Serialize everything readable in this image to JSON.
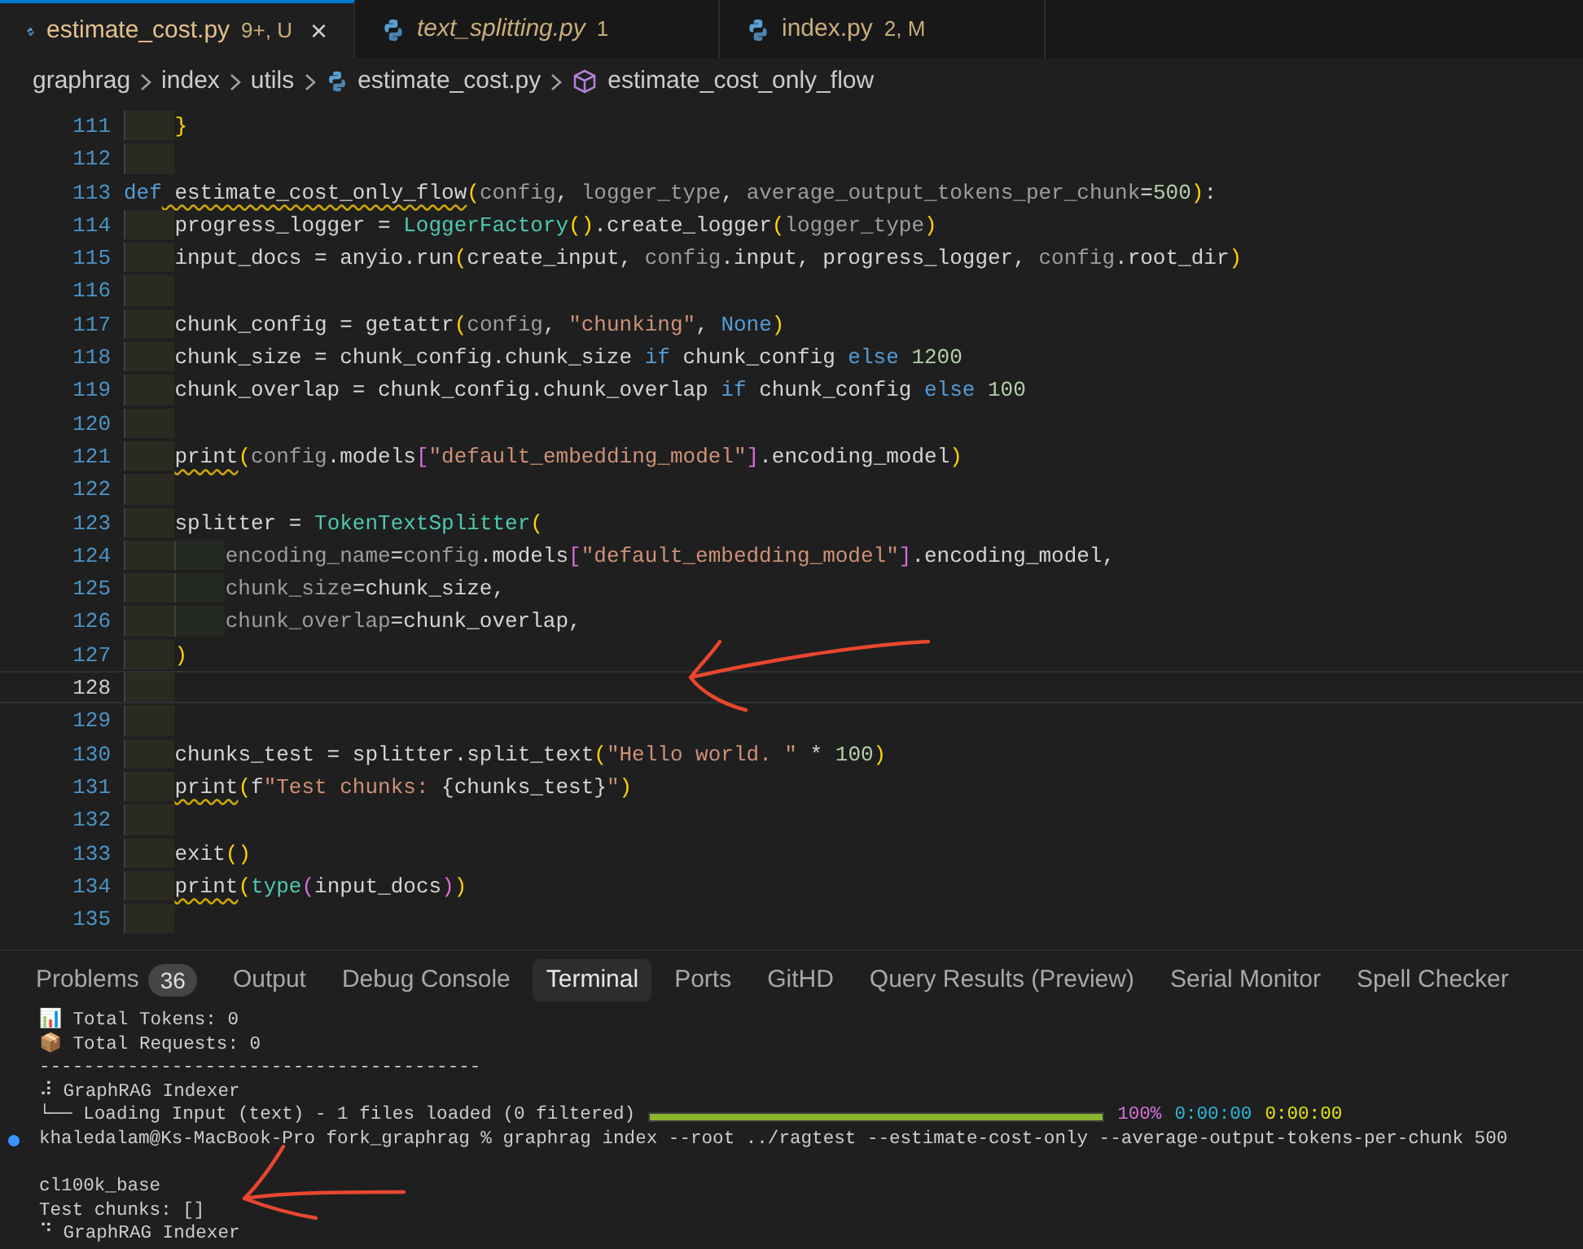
{
  "tabs": [
    {
      "label": "estimate_cost.py",
      "badge": "9+, U",
      "selected": true,
      "preview": false,
      "close": "×"
    },
    {
      "label": "text_splitting.py",
      "badge": "1",
      "selected": false,
      "preview": true
    },
    {
      "label": "index.py",
      "badge": "2, M",
      "selected": false,
      "preview": false
    }
  ],
  "breadcrumbs": [
    {
      "label": "graphrag",
      "kind": "folder"
    },
    {
      "label": "index",
      "kind": "folder"
    },
    {
      "label": "utils",
      "kind": "folder"
    },
    {
      "label": "estimate_cost.py",
      "kind": "file"
    },
    {
      "label": "estimate_cost_only_flow",
      "kind": "symbol"
    }
  ],
  "code_lines": [
    {
      "number": "111",
      "current": false,
      "tokens": [
        {
          "text": "    }",
          "kind": "brace"
        }
      ]
    },
    {
      "number": "112",
      "current": false
    },
    {
      "number": "113",
      "current": false,
      "tokens": [
        {
          "text": "def",
          "kind": "keyword"
        },
        {
          "text": " estimate_cost_only_flow",
          "kind": "plain",
          "squiggle": true
        },
        {
          "text": "(",
          "kind": "brace"
        },
        {
          "text": "config",
          "kind": "param"
        },
        {
          "text": ", ",
          "kind": "plain"
        },
        {
          "text": "logger_type",
          "kind": "param"
        },
        {
          "text": ", ",
          "kind": "plain"
        },
        {
          "text": "average_output_tokens_per_chunk",
          "kind": "param"
        },
        {
          "text": "=",
          "kind": "plain"
        },
        {
          "text": "500",
          "kind": "number"
        },
        {
          "text": ")",
          "kind": "brace"
        },
        {
          "text": ":",
          "kind": "plain"
        }
      ]
    },
    {
      "number": "114",
      "current": false,
      "tokens": [
        {
          "text": "    progress_logger = ",
          "kind": "plain"
        },
        {
          "text": "LoggerFactory",
          "kind": "class"
        },
        {
          "text": "()",
          "kind": "brace"
        },
        {
          "text": ".create_logger",
          "kind": "plain"
        },
        {
          "text": "(",
          "kind": "brace"
        },
        {
          "text": "logger_type",
          "kind": "param"
        },
        {
          "text": ")",
          "kind": "brace"
        }
      ]
    },
    {
      "number": "115",
      "current": false,
      "tokens": [
        {
          "text": "    input_docs = anyio.run",
          "kind": "plain"
        },
        {
          "text": "(",
          "kind": "brace"
        },
        {
          "text": "create_input, ",
          "kind": "plain"
        },
        {
          "text": "config",
          "kind": "param"
        },
        {
          "text": ".input, progress_logger, ",
          "kind": "plain"
        },
        {
          "text": "config",
          "kind": "param"
        },
        {
          "text": ".root_dir",
          "kind": "plain"
        },
        {
          "text": ")",
          "kind": "brace"
        }
      ]
    },
    {
      "number": "116",
      "current": false
    },
    {
      "number": "117",
      "current": false,
      "tokens": [
        {
          "text": "    chunk_config = getattr",
          "kind": "plain"
        },
        {
          "text": "(",
          "kind": "brace"
        },
        {
          "text": "config",
          "kind": "param"
        },
        {
          "text": ", ",
          "kind": "plain"
        },
        {
          "text": "\"chunking\"",
          "kind": "string"
        },
        {
          "text": ", ",
          "kind": "plain"
        },
        {
          "text": "None",
          "kind": "keyword"
        },
        {
          "text": ")",
          "kind": "brace"
        }
      ]
    },
    {
      "number": "118",
      "current": false,
      "tokens": [
        {
          "text": "    chunk_size = chunk_config.chunk_size ",
          "kind": "plain"
        },
        {
          "text": "if",
          "kind": "keyword"
        },
        {
          "text": " chunk_config ",
          "kind": "plain"
        },
        {
          "text": "else",
          "kind": "keyword"
        },
        {
          "text": " 1200",
          "kind": "number"
        }
      ]
    },
    {
      "number": "119",
      "current": false,
      "tokens": [
        {
          "text": "    chunk_overlap = chunk_config.chunk_overlap ",
          "kind": "plain"
        },
        {
          "text": "if",
          "kind": "keyword"
        },
        {
          "text": " chunk_config ",
          "kind": "plain"
        },
        {
          "text": "else",
          "kind": "keyword"
        },
        {
          "text": " 100",
          "kind": "number"
        }
      ]
    },
    {
      "number": "120",
      "current": false
    },
    {
      "number": "121",
      "current": false,
      "tokens": [
        {
          "text": "    print",
          "kind": "plain",
          "squiggle": true
        },
        {
          "text": "(",
          "kind": "brace"
        },
        {
          "text": "config",
          "kind": "param"
        },
        {
          "text": ".models",
          "kind": "plain"
        },
        {
          "text": "[",
          "kind": "bracket"
        },
        {
          "text": "\"default_embedding_model\"",
          "kind": "string"
        },
        {
          "text": "]",
          "kind": "bracket"
        },
        {
          "text": ".encoding_model",
          "kind": "plain"
        },
        {
          "text": ")",
          "kind": "brace"
        }
      ]
    },
    {
      "number": "122",
      "current": false
    },
    {
      "number": "123",
      "current": false,
      "tokens": [
        {
          "text": "    splitter = ",
          "kind": "plain"
        },
        {
          "text": "TokenTextSplitter",
          "kind": "class"
        },
        {
          "text": "(",
          "kind": "brace"
        }
      ]
    },
    {
      "number": "124",
      "current": false,
      "tokens": [
        {
          "text": "        encoding_name",
          "kind": "param"
        },
        {
          "text": "=",
          "kind": "plain"
        },
        {
          "text": "config",
          "kind": "param"
        },
        {
          "text": ".models",
          "kind": "plain"
        },
        {
          "text": "[",
          "kind": "bracket"
        },
        {
          "text": "\"default_embedding_model\"",
          "kind": "string"
        },
        {
          "text": "]",
          "kind": "bracket"
        },
        {
          "text": ".encoding_model,",
          "kind": "plain"
        }
      ]
    },
    {
      "number": "125",
      "current": false,
      "tokens": [
        {
          "text": "        chunk_size",
          "kind": "param"
        },
        {
          "text": "=chunk_size,",
          "kind": "plain"
        }
      ]
    },
    {
      "number": "126",
      "current": false,
      "tokens": [
        {
          "text": "        chunk_overlap",
          "kind": "param"
        },
        {
          "text": "=chunk_overlap,",
          "kind": "plain"
        }
      ]
    },
    {
      "number": "127",
      "current": false,
      "tokens": [
        {
          "text": "    )",
          "kind": "brace"
        }
      ]
    },
    {
      "number": "128",
      "current": true
    },
    {
      "number": "129",
      "current": false
    },
    {
      "number": "130",
      "current": false,
      "tokens": [
        {
          "text": "    chunks_test = splitter.split_text",
          "kind": "plain"
        },
        {
          "text": "(",
          "kind": "brace"
        },
        {
          "text": "\"Hello world. \"",
          "kind": "string"
        },
        {
          "text": " * ",
          "kind": "plain"
        },
        {
          "text": "100",
          "kind": "number"
        },
        {
          "text": ")",
          "kind": "brace"
        }
      ]
    },
    {
      "number": "131",
      "current": false,
      "tokens": [
        {
          "text": "    print",
          "kind": "plain",
          "squiggle": true
        },
        {
          "text": "(",
          "kind": "brace"
        },
        {
          "text": "f",
          "kind": "plain"
        },
        {
          "text": "\"Test chunks: ",
          "kind": "string"
        },
        {
          "text": "{chunks_test}",
          "kind": "plain"
        },
        {
          "text": "\"",
          "kind": "string"
        },
        {
          "text": ")",
          "kind": "brace"
        }
      ]
    },
    {
      "number": "132",
      "current": false
    },
    {
      "number": "133",
      "current": false,
      "tokens": [
        {
          "text": "    exit",
          "kind": "plain"
        },
        {
          "text": "()",
          "kind": "brace"
        }
      ]
    },
    {
      "number": "134",
      "current": false,
      "tokens": [
        {
          "text": "    print",
          "kind": "plain",
          "squiggle": true
        },
        {
          "text": "(",
          "kind": "brace"
        },
        {
          "text": "type",
          "kind": "class"
        },
        {
          "text": "(",
          "kind": "bracket"
        },
        {
          "text": "input_docs",
          "kind": "plain"
        },
        {
          "text": ")",
          "kind": "bracket"
        },
        {
          "text": ")",
          "kind": "brace"
        }
      ]
    },
    {
      "number": "135",
      "current": false
    }
  ],
  "panel_tabs": [
    {
      "label": "Problems",
      "badge": "36",
      "selected": false
    },
    {
      "label": "Output",
      "selected": false
    },
    {
      "label": "Debug Console",
      "selected": false
    },
    {
      "label": "Terminal",
      "selected": true
    },
    {
      "label": "Ports",
      "selected": false
    },
    {
      "label": "GitHD",
      "selected": false
    },
    {
      "label": "Query Results (Preview)",
      "selected": false
    },
    {
      "label": "Serial Monitor",
      "selected": false
    },
    {
      "label": "Spell Checker",
      "selected": false
    }
  ],
  "terminal_lines": [
    {
      "kind": "text",
      "parts": [
        {
          "text": "📊 Total Tokens: 0",
          "kind": "plain"
        }
      ]
    },
    {
      "kind": "text",
      "parts": [
        {
          "text": "📦 Total Requests: 0",
          "kind": "plain"
        }
      ]
    },
    {
      "kind": "text",
      "parts": [
        {
          "text": "----------------------------------------",
          "kind": "plain"
        }
      ]
    },
    {
      "kind": "text",
      "parts": [
        {
          "text": "⠼ GraphRAG Indexer",
          "kind": "plain"
        }
      ]
    },
    {
      "kind": "progress",
      "level": 1,
      "parts": [
        {
          "text": "└── Loading Input (text) - 1 files loaded (0 filtered)",
          "kind": "plain"
        },
        {
          "text": "100%",
          "kind": "magenta"
        },
        {
          "text": "0:00:00",
          "kind": "cyan"
        },
        {
          "text": "0:00:00",
          "kind": "yellow"
        }
      ]
    },
    {
      "kind": "prompt",
      "parts": [
        {
          "text": "khaledalam@Ks-MacBook-Pro fork_graphrag % graphrag index --root ../ragtest --estimate-cost-only --average-output-tokens-per-chunk 500",
          "kind": "plain"
        }
      ]
    },
    {
      "kind": "blank"
    },
    {
      "kind": "text",
      "parts": [
        {
          "text": "cl100k_base",
          "kind": "plain"
        }
      ]
    },
    {
      "kind": "text",
      "parts": [
        {
          "text": "Test chunks: []",
          "kind": "plain"
        }
      ]
    },
    {
      "kind": "text",
      "parts": [
        {
          "text": "⠙ GraphRAG Indexer",
          "kind": "plain"
        }
      ]
    }
  ]
}
